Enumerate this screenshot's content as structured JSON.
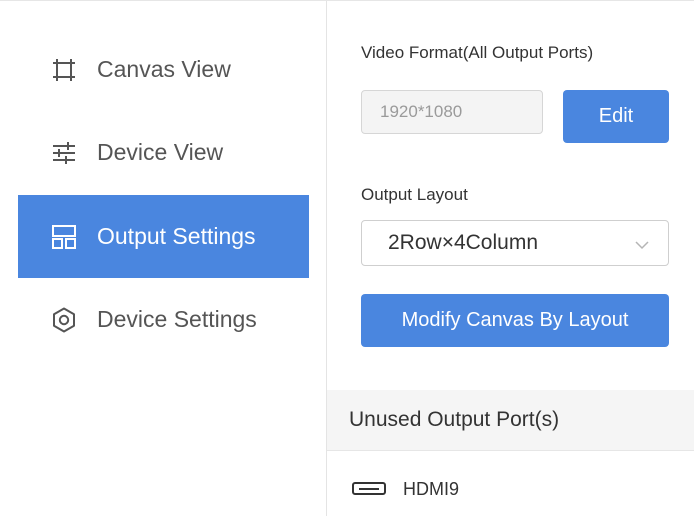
{
  "sidebar": {
    "items": [
      {
        "label": "Canvas View",
        "icon": "canvas-view-icon",
        "active": false
      },
      {
        "label": "Device View",
        "icon": "sliders-icon",
        "active": false
      },
      {
        "label": "Output Settings",
        "icon": "layout-grid-icon",
        "active": true
      },
      {
        "label": "Device Settings",
        "icon": "gear-icon",
        "active": false
      }
    ]
  },
  "panel": {
    "video_format_label": "Video Format(All Output Ports)",
    "video_format_value": "1920*1080",
    "edit_button": "Edit",
    "output_layout_label": "Output Layout",
    "output_layout_value": "2Row×4Column",
    "modify_button": "Modify Canvas By Layout",
    "unused_ports_header": "Unused Output Port(s)",
    "unused_ports": [
      {
        "label": "HDMI9",
        "icon": "hdmi-port-icon"
      }
    ]
  },
  "colors": {
    "accent": "#4a86df",
    "text": "#333333",
    "muted_text": "#9a9a9a",
    "sidebar_text": "#555555"
  }
}
